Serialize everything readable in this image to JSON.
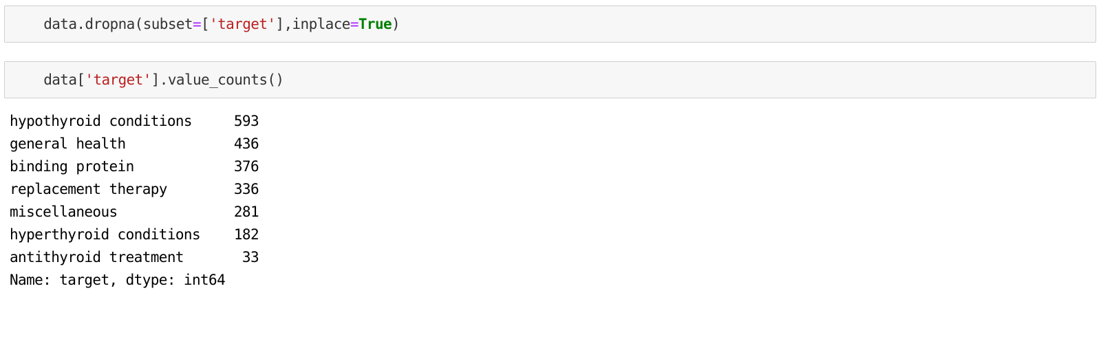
{
  "cells": [
    {
      "tokens": [
        {
          "text": "data.dropna(subset",
          "kind": "plain"
        },
        {
          "text": "=",
          "kind": "op"
        },
        {
          "text": "[",
          "kind": "plain"
        },
        {
          "text": "'target'",
          "kind": "str"
        },
        {
          "text": "],inplace",
          "kind": "plain"
        },
        {
          "text": "=",
          "kind": "op"
        },
        {
          "text": "True",
          "kind": "kw"
        },
        {
          "text": ")",
          "kind": "plain"
        }
      ]
    },
    {
      "tokens": [
        {
          "text": "data[",
          "kind": "plain"
        },
        {
          "text": "'target'",
          "kind": "str"
        },
        {
          "text": "].value_counts()",
          "kind": "plain"
        }
      ],
      "output": {
        "rows": [
          {
            "label": "hypothyroid conditions",
            "count": "593"
          },
          {
            "label": "general health",
            "count": "436"
          },
          {
            "label": "binding protein",
            "count": "376"
          },
          {
            "label": "replacement therapy",
            "count": "336"
          },
          {
            "label": "miscellaneous",
            "count": "281"
          },
          {
            "label": "hyperthyroid conditions",
            "count": "182"
          },
          {
            "label": "antithyroid treatment",
            "count": "33"
          }
        ],
        "footer": "Name: target, dtype: int64"
      }
    }
  ],
  "colors": {
    "cell_bg": "#f7f7f7",
    "cell_border": "#cfcfcf",
    "operator": "#aa22ff",
    "string": "#ba2121",
    "keyword": "#008000"
  }
}
